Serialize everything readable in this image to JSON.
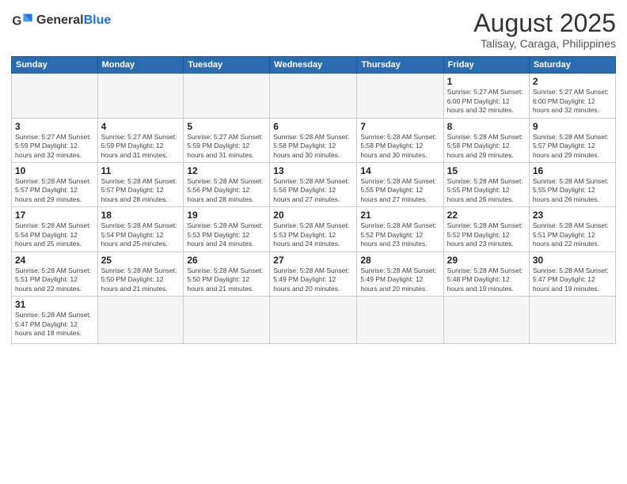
{
  "logo": {
    "text_general": "General",
    "text_blue": "Blue"
  },
  "title": {
    "month_year": "August 2025",
    "location": "Talisay, Caraga, Philippines"
  },
  "days_of_week": [
    "Sunday",
    "Monday",
    "Tuesday",
    "Wednesday",
    "Thursday",
    "Friday",
    "Saturday"
  ],
  "weeks": [
    [
      {
        "day": "",
        "info": ""
      },
      {
        "day": "",
        "info": ""
      },
      {
        "day": "",
        "info": ""
      },
      {
        "day": "",
        "info": ""
      },
      {
        "day": "",
        "info": ""
      },
      {
        "day": "1",
        "info": "Sunrise: 5:27 AM\nSunset: 6:00 PM\nDaylight: 12 hours and 32 minutes."
      },
      {
        "day": "2",
        "info": "Sunrise: 5:27 AM\nSunset: 6:00 PM\nDaylight: 12 hours and 32 minutes."
      }
    ],
    [
      {
        "day": "3",
        "info": "Sunrise: 5:27 AM\nSunset: 5:59 PM\nDaylight: 12 hours and 32 minutes."
      },
      {
        "day": "4",
        "info": "Sunrise: 5:27 AM\nSunset: 5:59 PM\nDaylight: 12 hours and 31 minutes."
      },
      {
        "day": "5",
        "info": "Sunrise: 5:27 AM\nSunset: 5:59 PM\nDaylight: 12 hours and 31 minutes."
      },
      {
        "day": "6",
        "info": "Sunrise: 5:28 AM\nSunset: 5:58 PM\nDaylight: 12 hours and 30 minutes."
      },
      {
        "day": "7",
        "info": "Sunrise: 5:28 AM\nSunset: 5:58 PM\nDaylight: 12 hours and 30 minutes."
      },
      {
        "day": "8",
        "info": "Sunrise: 5:28 AM\nSunset: 5:58 PM\nDaylight: 12 hours and 29 minutes."
      },
      {
        "day": "9",
        "info": "Sunrise: 5:28 AM\nSunset: 5:57 PM\nDaylight: 12 hours and 29 minutes."
      }
    ],
    [
      {
        "day": "10",
        "info": "Sunrise: 5:28 AM\nSunset: 5:57 PM\nDaylight: 12 hours and 29 minutes."
      },
      {
        "day": "11",
        "info": "Sunrise: 5:28 AM\nSunset: 5:57 PM\nDaylight: 12 hours and 28 minutes."
      },
      {
        "day": "12",
        "info": "Sunrise: 5:28 AM\nSunset: 5:56 PM\nDaylight: 12 hours and 28 minutes."
      },
      {
        "day": "13",
        "info": "Sunrise: 5:28 AM\nSunset: 5:56 PM\nDaylight: 12 hours and 27 minutes."
      },
      {
        "day": "14",
        "info": "Sunrise: 5:28 AM\nSunset: 5:55 PM\nDaylight: 12 hours and 27 minutes."
      },
      {
        "day": "15",
        "info": "Sunrise: 5:28 AM\nSunset: 5:55 PM\nDaylight: 12 hours and 26 minutes."
      },
      {
        "day": "16",
        "info": "Sunrise: 5:28 AM\nSunset: 5:55 PM\nDaylight: 12 hours and 26 minutes."
      }
    ],
    [
      {
        "day": "17",
        "info": "Sunrise: 5:28 AM\nSunset: 5:54 PM\nDaylight: 12 hours and 25 minutes."
      },
      {
        "day": "18",
        "info": "Sunrise: 5:28 AM\nSunset: 5:54 PM\nDaylight: 12 hours and 25 minutes."
      },
      {
        "day": "19",
        "info": "Sunrise: 5:28 AM\nSunset: 5:53 PM\nDaylight: 12 hours and 24 minutes."
      },
      {
        "day": "20",
        "info": "Sunrise: 5:28 AM\nSunset: 5:53 PM\nDaylight: 12 hours and 24 minutes."
      },
      {
        "day": "21",
        "info": "Sunrise: 5:28 AM\nSunset: 5:52 PM\nDaylight: 12 hours and 23 minutes."
      },
      {
        "day": "22",
        "info": "Sunrise: 5:28 AM\nSunset: 5:52 PM\nDaylight: 12 hours and 23 minutes."
      },
      {
        "day": "23",
        "info": "Sunrise: 5:28 AM\nSunset: 5:51 PM\nDaylight: 12 hours and 22 minutes."
      }
    ],
    [
      {
        "day": "24",
        "info": "Sunrise: 5:28 AM\nSunset: 5:51 PM\nDaylight: 12 hours and 22 minutes."
      },
      {
        "day": "25",
        "info": "Sunrise: 5:28 AM\nSunset: 5:50 PM\nDaylight: 12 hours and 21 minutes."
      },
      {
        "day": "26",
        "info": "Sunrise: 5:28 AM\nSunset: 5:50 PM\nDaylight: 12 hours and 21 minutes."
      },
      {
        "day": "27",
        "info": "Sunrise: 5:28 AM\nSunset: 5:49 PM\nDaylight: 12 hours and 20 minutes."
      },
      {
        "day": "28",
        "info": "Sunrise: 5:28 AM\nSunset: 5:49 PM\nDaylight: 12 hours and 20 minutes."
      },
      {
        "day": "29",
        "info": "Sunrise: 5:28 AM\nSunset: 5:48 PM\nDaylight: 12 hours and 19 minutes."
      },
      {
        "day": "30",
        "info": "Sunrise: 5:28 AM\nSunset: 5:47 PM\nDaylight: 12 hours and 19 minutes."
      }
    ],
    [
      {
        "day": "31",
        "info": "Sunrise: 5:28 AM\nSunset: 5:47 PM\nDaylight: 12 hours and 18 minutes."
      },
      {
        "day": "",
        "info": ""
      },
      {
        "day": "",
        "info": ""
      },
      {
        "day": "",
        "info": ""
      },
      {
        "day": "",
        "info": ""
      },
      {
        "day": "",
        "info": ""
      },
      {
        "day": "",
        "info": ""
      }
    ]
  ]
}
